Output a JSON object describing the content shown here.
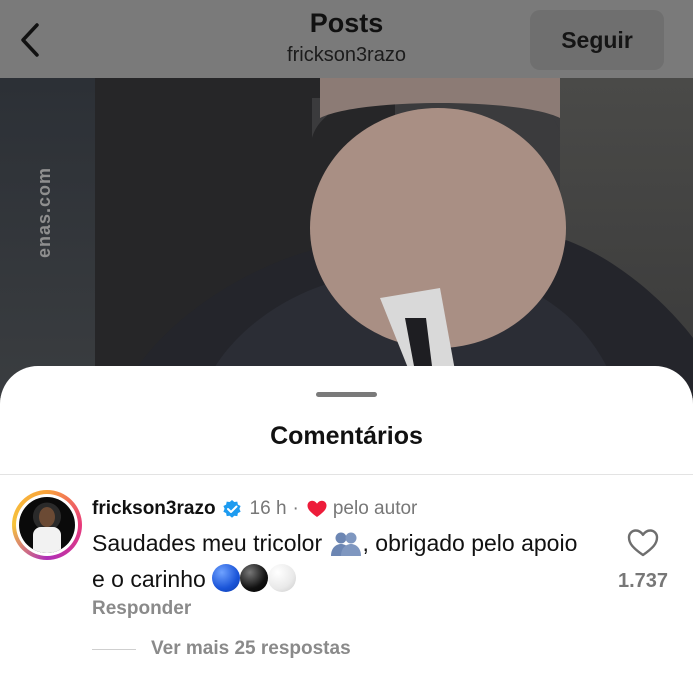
{
  "header": {
    "title": "Posts",
    "subtitle": "frickson3razo",
    "follow_label": "Seguir"
  },
  "media": {
    "watermark": "enas.com"
  },
  "sheet": {
    "title": "Comentários"
  },
  "comment": {
    "username": "frickson3razo",
    "time": "16 h",
    "separator": "·",
    "liked_by_author_label": "pelo autor",
    "text_part1": "Saudades meu tricolor",
    "text_part2": ", obrigado pelo apoio e o carinho",
    "reply_label": "Responder",
    "like_count": "1.737",
    "view_more_replies": "Ver mais 25 respostas"
  },
  "colors": {
    "verified_blue": "#1d9bf0",
    "heart_red": "#ed1c3a",
    "muted_text": "#8a8a8a"
  },
  "icons": {
    "back": "chevron-left-icon",
    "verified": "verified-badge-icon",
    "author_like": "heart-filled-icon",
    "like": "heart-outline-icon"
  }
}
